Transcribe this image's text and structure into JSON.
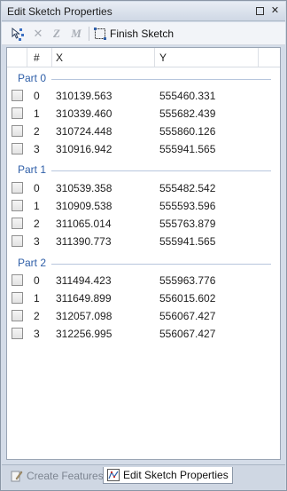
{
  "window": {
    "title": "Edit Sketch Properties"
  },
  "toolbar": {
    "finish_label": "Finish Sketch"
  },
  "grid": {
    "headers": {
      "hash": "#",
      "x": "X",
      "y": "Y"
    },
    "parts": [
      {
        "label": "Part 0",
        "rows": [
          {
            "idx": "0",
            "x": "310139.563",
            "y": "555460.331"
          },
          {
            "idx": "1",
            "x": "310339.460",
            "y": "555682.439"
          },
          {
            "idx": "2",
            "x": "310724.448",
            "y": "555860.126"
          },
          {
            "idx": "3",
            "x": "310916.942",
            "y": "555941.565"
          }
        ]
      },
      {
        "label": "Part 1",
        "rows": [
          {
            "idx": "0",
            "x": "310539.358",
            "y": "555482.542"
          },
          {
            "idx": "1",
            "x": "310909.538",
            "y": "555593.596"
          },
          {
            "idx": "2",
            "x": "311065.014",
            "y": "555763.879"
          },
          {
            "idx": "3",
            "x": "311390.773",
            "y": "555941.565"
          }
        ]
      },
      {
        "label": "Part 2",
        "rows": [
          {
            "idx": "0",
            "x": "311494.423",
            "y": "555963.776"
          },
          {
            "idx": "1",
            "x": "311649.899",
            "y": "556015.602"
          },
          {
            "idx": "2",
            "x": "312057.098",
            "y": "556067.427"
          },
          {
            "idx": "3",
            "x": "312256.995",
            "y": "556067.427"
          }
        ]
      }
    ]
  },
  "tabs": [
    {
      "label": "Create Features",
      "icon": "create-features-icon",
      "active": false
    },
    {
      "label": "Edit Sketch Properties",
      "icon": "edit-sketch-icon",
      "active": true
    }
  ],
  "colors": {
    "part_label": "#2f5fa8",
    "title_bg": "#d4dce8"
  }
}
